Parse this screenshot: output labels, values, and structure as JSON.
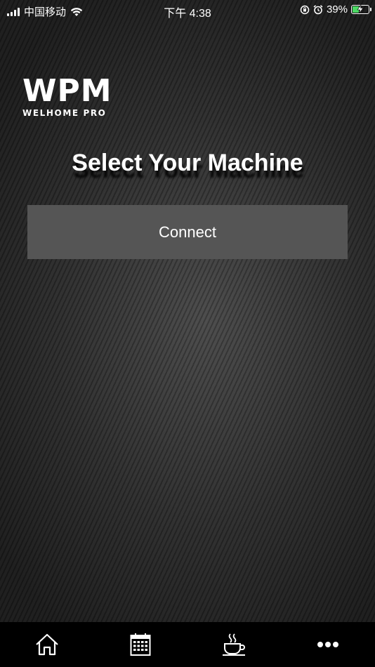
{
  "status_bar": {
    "carrier": "中国移动",
    "time": "下午 4:38",
    "battery_percent": "39%",
    "battery_level": 0.39,
    "icons": [
      "signal-icon",
      "wifi-icon",
      "orientation-lock-icon",
      "alarm-icon",
      "battery-charging-icon"
    ]
  },
  "logo": {
    "main": "WPM",
    "sub": "WELHOME PRO"
  },
  "page_title": "Select Your Machine",
  "connect_label": "Connect",
  "tab_bar": {
    "items": [
      "home-icon",
      "calendar-icon",
      "coffee-cup-icon",
      "more-icon"
    ]
  },
  "colors": {
    "button_bg": "#555555",
    "tab_bar_bg": "#000000",
    "battery_fill": "#4cd964"
  }
}
